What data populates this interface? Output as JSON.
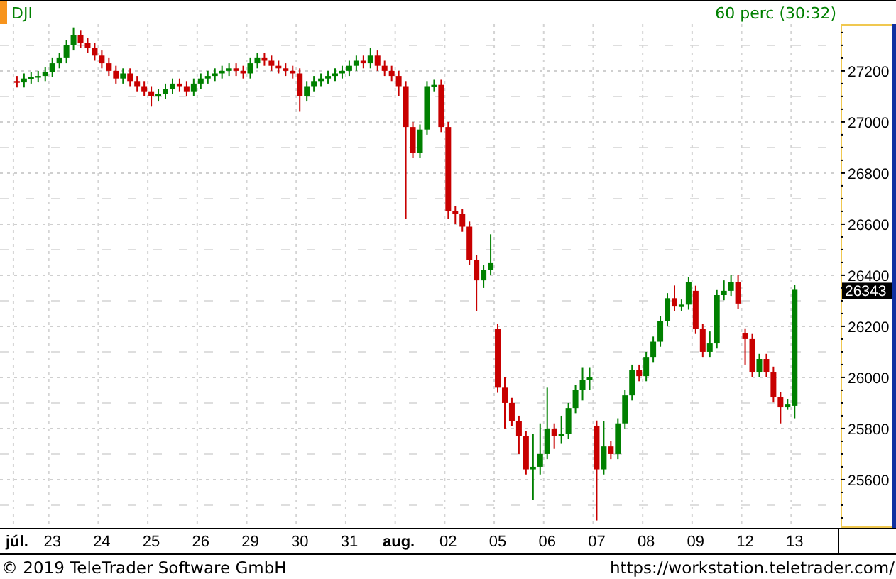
{
  "header": {
    "symbol": "DJI",
    "interval": "60 perc (30:32)"
  },
  "chart": {
    "last_price": "26343",
    "chart_data": {
      "type": "candlestick",
      "grid": true,
      "ylim": [
        25411,
        27383
      ],
      "yticks": [
        25600,
        25800,
        26000,
        26200,
        26400,
        26600,
        26800,
        27000,
        27200
      ],
      "categories": [
        "júl.",
        null,
        null,
        null,
        null,
        "23",
        null,
        null,
        null,
        null,
        null,
        null,
        "24",
        null,
        null,
        null,
        null,
        null,
        null,
        "25",
        null,
        null,
        null,
        null,
        null,
        null,
        "26",
        null,
        null,
        null,
        null,
        null,
        null,
        "29",
        null,
        null,
        null,
        null,
        null,
        null,
        "30",
        null,
        null,
        null,
        null,
        null,
        null,
        "31",
        null,
        null,
        null,
        null,
        null,
        null,
        "aug.",
        null,
        null,
        null,
        null,
        null,
        null,
        "02",
        null,
        null,
        null,
        null,
        null,
        null,
        "05",
        null,
        null,
        null,
        null,
        null,
        null,
        "06",
        null,
        null,
        null,
        null,
        null,
        null,
        "07",
        null,
        null,
        null,
        null,
        null,
        null,
        "08",
        null,
        null,
        null,
        null,
        null,
        null,
        "09",
        null,
        null,
        null,
        null,
        null,
        null,
        "12",
        null,
        null,
        null,
        null,
        null,
        null,
        "13"
      ],
      "ohlc": [
        [
          27160,
          27180,
          27135,
          27155
        ],
        [
          27155,
          27190,
          27135,
          27170
        ],
        [
          27170,
          27195,
          27150,
          27175
        ],
        [
          27175,
          27200,
          27155,
          27180
        ],
        [
          27180,
          27215,
          27160,
          27195
        ],
        [
          27195,
          27250,
          27175,
          27230
        ],
        [
          27230,
          27270,
          27210,
          27250
        ],
        [
          27250,
          27320,
          27230,
          27300
        ],
        [
          27300,
          27370,
          27280,
          27340
        ],
        [
          27340,
          27360,
          27290,
          27310
        ],
        [
          27310,
          27330,
          27270,
          27290
        ],
        [
          27290,
          27310,
          27240,
          27260
        ],
        [
          27260,
          27280,
          27210,
          27230
        ],
        [
          27230,
          27250,
          27180,
          27200
        ],
        [
          27200,
          27220,
          27150,
          27170
        ],
        [
          27170,
          27210,
          27150,
          27190
        ],
        [
          27190,
          27210,
          27140,
          27160
        ],
        [
          27160,
          27180,
          27120,
          27140
        ],
        [
          27140,
          27160,
          27100,
          27120
        ],
        [
          27120,
          27140,
          27060,
          27100
        ],
        [
          27100,
          27130,
          27080,
          27110
        ],
        [
          27110,
          27150,
          27090,
          27130
        ],
        [
          27130,
          27170,
          27110,
          27150
        ],
        [
          27150,
          27170,
          27120,
          27140
        ],
        [
          27140,
          27160,
          27100,
          27120
        ],
        [
          27120,
          27170,
          27100,
          27150
        ],
        [
          27150,
          27190,
          27130,
          27170
        ],
        [
          27170,
          27200,
          27150,
          27180
        ],
        [
          27180,
          27210,
          27160,
          27190
        ],
        [
          27190,
          27220,
          27170,
          27200
        ],
        [
          27200,
          27230,
          27180,
          27210
        ],
        [
          27210,
          27230,
          27180,
          27200
        ],
        [
          27200,
          27220,
          27170,
          27190
        ],
        [
          27190,
          27250,
          27170,
          27230
        ],
        [
          27230,
          27270,
          27210,
          27250
        ],
        [
          27250,
          27270,
          27220,
          27240
        ],
        [
          27240,
          27260,
          27200,
          27220
        ],
        [
          27220,
          27240,
          27190,
          27210
        ],
        [
          27210,
          27230,
          27180,
          27200
        ],
        [
          27200,
          27220,
          27170,
          27190
        ],
        [
          27190,
          27210,
          27040,
          27100
        ],
        [
          27100,
          27160,
          27080,
          27140
        ],
        [
          27140,
          27180,
          27120,
          27160
        ],
        [
          27160,
          27190,
          27140,
          27170
        ],
        [
          27170,
          27200,
          27150,
          27180
        ],
        [
          27180,
          27210,
          27160,
          27190
        ],
        [
          27190,
          27220,
          27170,
          27200
        ],
        [
          27200,
          27240,
          27180,
          27220
        ],
        [
          27220,
          27260,
          27200,
          27240
        ],
        [
          27240,
          27260,
          27210,
          27230
        ],
        [
          27230,
          27290,
          27210,
          27260
        ],
        [
          27260,
          27280,
          27200,
          27220
        ],
        [
          27220,
          27240,
          27180,
          27200
        ],
        [
          27200,
          27220,
          27160,
          27180
        ],
        [
          27180,
          27200,
          27100,
          27140
        ],
        [
          27140,
          27160,
          26620,
          26980
        ],
        [
          26980,
          27000,
          26860,
          26880
        ],
        [
          26880,
          26990,
          26860,
          26970
        ],
        [
          26970,
          27160,
          26950,
          27140
        ],
        [
          27140,
          27165,
          27120,
          27145
        ],
        [
          27145,
          27165,
          26960,
          26980
        ],
        [
          26980,
          27000,
          26620,
          26650
        ],
        [
          26650,
          26670,
          26600,
          26640
        ],
        [
          26640,
          26660,
          26570,
          26590
        ],
        [
          26590,
          26610,
          26440,
          26460
        ],
        [
          26460,
          26480,
          26260,
          26380
        ],
        [
          26380,
          26440,
          26350,
          26420
        ],
        [
          26420,
          26560,
          26400,
          26450
        ],
        [
          26190,
          26210,
          25940,
          25960
        ],
        [
          25960,
          26000,
          25800,
          25900
        ],
        [
          25900,
          25920,
          25810,
          25830
        ],
        [
          25830,
          25850,
          25700,
          25770
        ],
        [
          25770,
          25790,
          25620,
          25640
        ],
        [
          25640,
          25780,
          25520,
          25650
        ],
        [
          25650,
          25820,
          25620,
          25700
        ],
        [
          25700,
          25960,
          25680,
          25800
        ],
        [
          25800,
          25820,
          25720,
          25770
        ],
        [
          25770,
          25850,
          25740,
          25780
        ],
        [
          25780,
          25900,
          25760,
          25880
        ],
        [
          25880,
          25970,
          25860,
          25950
        ],
        [
          25950,
          26040,
          25910,
          25990
        ],
        [
          25990,
          26040,
          25950,
          26000
        ],
        [
          25811,
          25831,
          25440,
          25640
        ],
        [
          25640,
          25830,
          25620,
          25730
        ],
        [
          25730,
          25750,
          25680,
          25700
        ],
        [
          25700,
          25840,
          25680,
          25820
        ],
        [
          25820,
          25950,
          25800,
          25930
        ],
        [
          25930,
          26050,
          25910,
          26030
        ],
        [
          26030,
          26050,
          25985,
          26005
        ],
        [
          26005,
          26100,
          25985,
          26080
        ],
        [
          26080,
          26160,
          26060,
          26140
        ],
        [
          26140,
          26240,
          26120,
          26220
        ],
        [
          26220,
          26330,
          26200,
          26310
        ],
        [
          26310,
          26360,
          26260,
          26280
        ],
        [
          26280,
          26305,
          26260,
          26285
        ],
        [
          26285,
          26392,
          26265,
          26372
        ],
        [
          26339,
          26359,
          26170,
          26190
        ],
        [
          26190,
          26210,
          26080,
          26100
        ],
        [
          26100,
          26180,
          26080,
          26133
        ],
        [
          26133,
          26342,
          26113,
          26322
        ],
        [
          26322,
          26380,
          26302,
          26339
        ],
        [
          26339,
          26400,
          26319,
          26372
        ],
        [
          26372,
          26400,
          26269,
          26289
        ],
        [
          26172,
          26192,
          26050,
          26150
        ],
        [
          26150,
          26170,
          26002,
          26022
        ],
        [
          26022,
          26092,
          26002,
          26072
        ],
        [
          26072,
          26092,
          26002,
          26022
        ],
        [
          26022,
          26042,
          25902,
          25922
        ],
        [
          25922,
          25942,
          25820,
          25883
        ],
        [
          25883,
          25914,
          25873,
          25894
        ],
        [
          25889,
          26363,
          25840,
          26343
        ]
      ]
    }
  },
  "footer": {
    "copyright": "© 2019 TeleTrader Software GmbH",
    "url": "https://workstation.teletrader.com/"
  }
}
